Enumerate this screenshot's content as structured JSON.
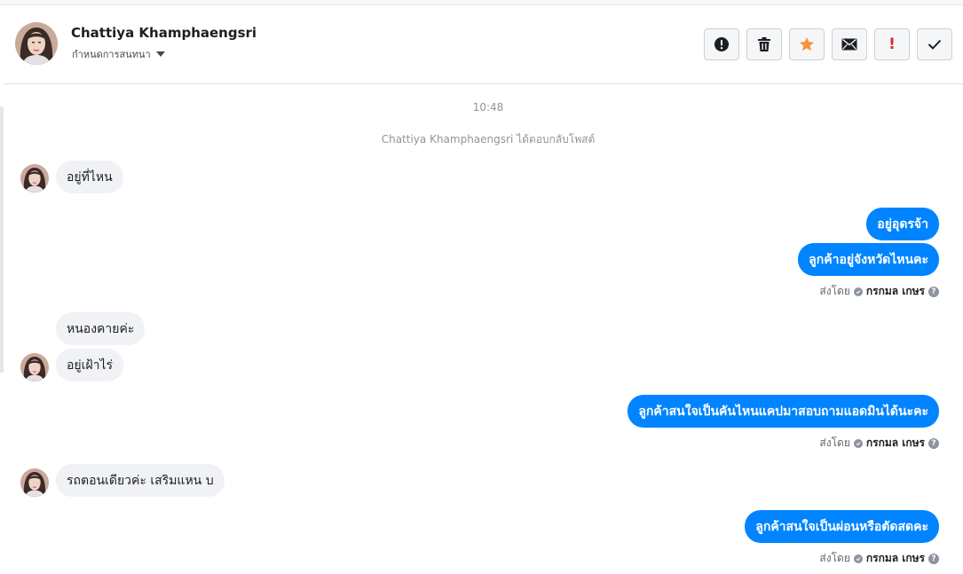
{
  "header": {
    "contact_name": "Chattiya Khamphaengsri",
    "conversation_menu": "กำหนดการสนทนา",
    "avatar_icon": "user-avatar-photo"
  },
  "toolbar": {
    "buttons": [
      {
        "icon": "alert-circle-icon"
      },
      {
        "icon": "trash-icon"
      },
      {
        "icon": "star-icon",
        "color": "#f7923a"
      },
      {
        "icon": "envelope-icon"
      },
      {
        "icon": "exclamation-icon",
        "text": "!",
        "color": "#e02424"
      },
      {
        "icon": "checkmark-icon"
      }
    ]
  },
  "thread": {
    "timestamp": "10:48",
    "system_note": "Chattiya Khamphaengsri ได้ตอบกลับโพสต์",
    "messages": [
      {
        "direction": "in",
        "text": "อยู่ที่ไหน"
      },
      {
        "direction": "out",
        "text": "อยู่อุดรจ้า"
      },
      {
        "direction": "out",
        "text": "ลูกค้าอยู่จังหวัดไหนคะ"
      },
      {
        "direction": "in",
        "text": "หนองคายค่ะ"
      },
      {
        "direction": "in",
        "text": "อยู่เฝ้าไร่"
      },
      {
        "direction": "out",
        "text": "ลูกค้าสนใจเป็นคันไหนแคปมาสอบถามแอดมินได้นะคะ"
      },
      {
        "direction": "in",
        "text": "รถตอนเดียวค่ะ เสริมแหน บ"
      },
      {
        "direction": "out",
        "text": "ลูกค้าสนใจเป็นผ่อนหรือตัดสดคะ"
      }
    ],
    "sent_by_label": "ส่งโดย",
    "sender_name": "กรกมล เกษร",
    "help_text": "?"
  },
  "colors": {
    "outgoing_bubble": "#0084ff",
    "incoming_bubble": "#f0f2f5"
  }
}
